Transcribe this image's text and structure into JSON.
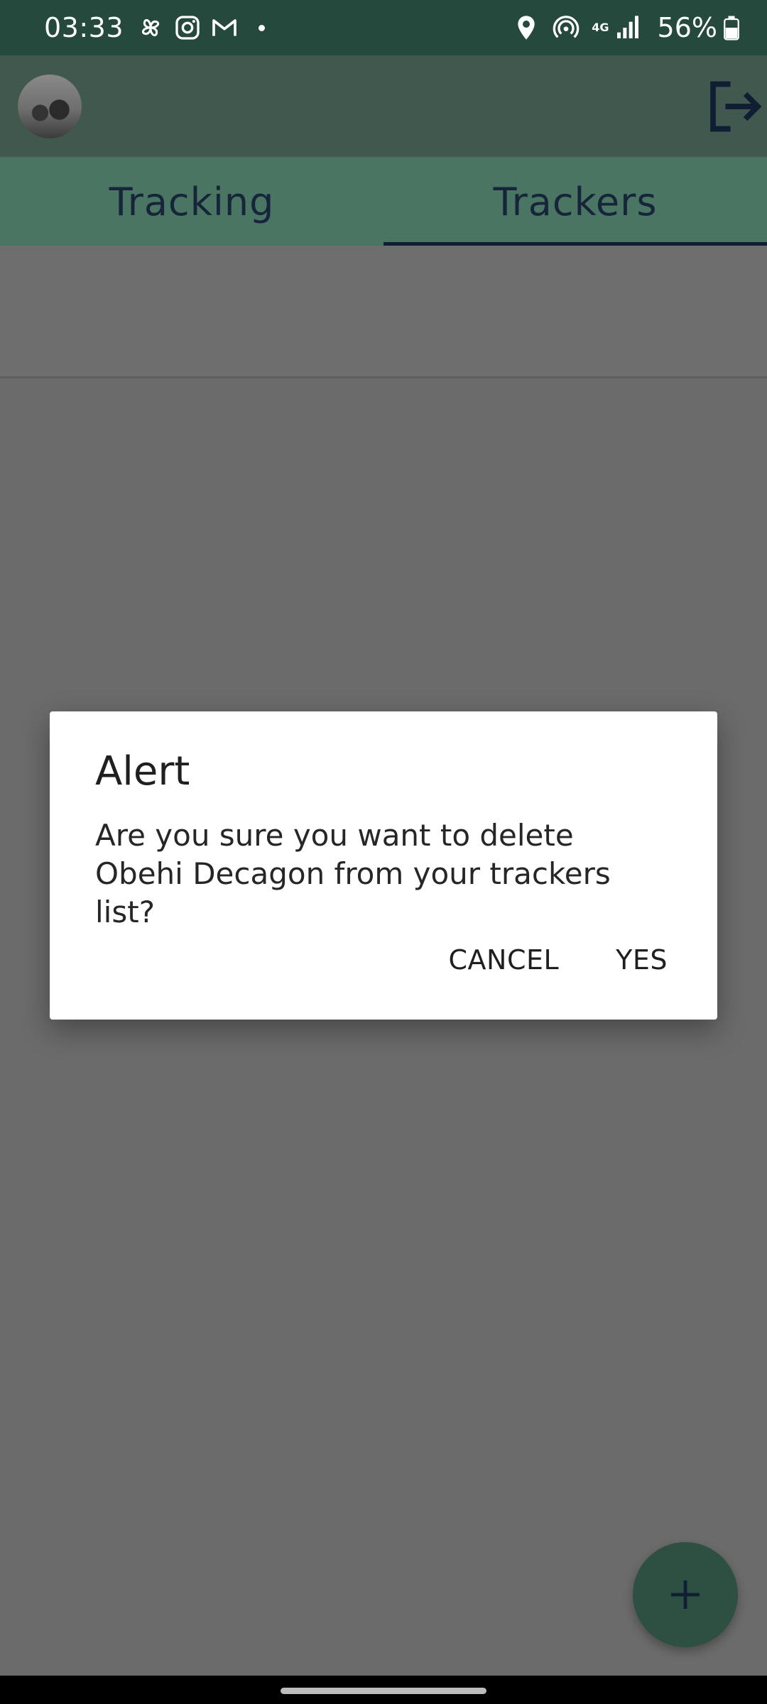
{
  "status_bar": {
    "time": "03:33",
    "network_type": "4G",
    "battery": "56%"
  },
  "app_bar": {
    "avatar_icon": "user-avatar",
    "logout_icon": "logout-icon"
  },
  "tabs": [
    {
      "label": "Tracking",
      "active": false
    },
    {
      "label": "Trackers",
      "active": true
    }
  ],
  "dialog": {
    "title": "Alert",
    "message": "Are you sure you want to delete Obehi Decagon from your trackers list?",
    "cancel_label": "CANCEL",
    "confirm_label": "YES"
  },
  "fab": {
    "icon": "plus-icon"
  },
  "colors": {
    "status_bar": "#254a3d",
    "app_bar": "#41584e",
    "tab_bar": "#4a7563",
    "scrim": "#6b6b6b",
    "fab": "#2e5043",
    "tab_text": "#17253a"
  }
}
